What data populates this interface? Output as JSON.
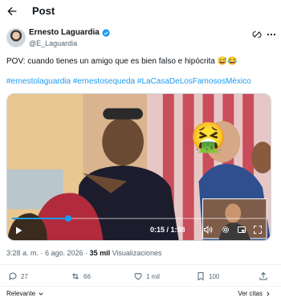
{
  "header": {
    "title": "Post"
  },
  "author": {
    "name": "Ernesto Laguardia",
    "handle": "@E_Laguardia"
  },
  "tweet": {
    "text": "POV: cuando tienes un amigo que es bien falso e hipócrita 😅😂",
    "hashtags": "#ernestolaguardia #ernestosequeda #LaCasaDeLosFamososMéxico"
  },
  "video": {
    "time": "0:15 / 1:08",
    "progress": 0.22,
    "emoji": "🤮"
  },
  "meta": {
    "time": "3:28 a. m. · 6 ago. 2026 · ",
    "views_count": "35 mil",
    "views_label": " Visualizaciones"
  },
  "actions": {
    "replies": "27",
    "reposts": "66",
    "likes": "1 mil",
    "bookmarks": "100"
  },
  "sort": {
    "label": "Relevante",
    "right_label": "Ver citas"
  },
  "colors": {
    "accent": "#1d9bf0",
    "text": "#0f1419",
    "muted": "#536471"
  }
}
